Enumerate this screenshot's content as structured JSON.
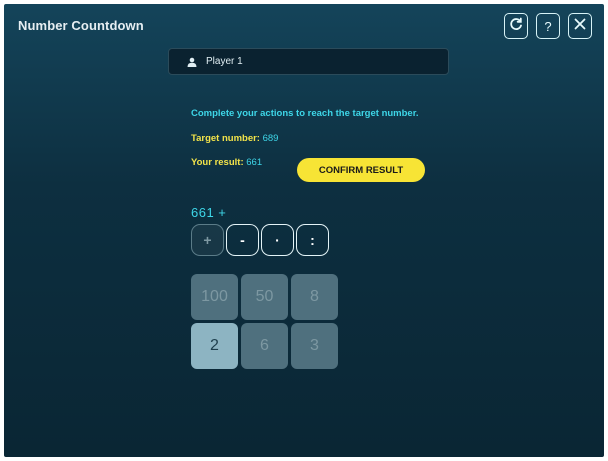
{
  "app": {
    "title": "Number Countdown"
  },
  "header_buttons": [
    {
      "name": "restart-button",
      "icon": "refresh-icon"
    },
    {
      "name": "help-button",
      "icon": "question-icon",
      "label": "?"
    },
    {
      "name": "close-button",
      "icon": "close-icon"
    }
  ],
  "player": {
    "name": "Player 1",
    "icon": "user-icon"
  },
  "instructions": "Complete your actions to reach the target number.",
  "target": {
    "label": "Target number:",
    "value": "689"
  },
  "result": {
    "label": "Your result:",
    "value": "661"
  },
  "confirm_label": "CONFIRM RESULT",
  "expression": "661 +",
  "operators": [
    {
      "symbol": "+",
      "state": "used"
    },
    {
      "symbol": "-",
      "state": "available"
    },
    {
      "symbol": "·",
      "state": "available"
    },
    {
      "symbol": ":",
      "state": "available"
    }
  ],
  "numbers": [
    {
      "value": "100",
      "state": "used"
    },
    {
      "value": "50",
      "state": "used"
    },
    {
      "value": "8",
      "state": "used"
    },
    {
      "value": "2",
      "state": "available"
    },
    {
      "value": "6",
      "state": "used"
    },
    {
      "value": "3",
      "state": "used"
    }
  ],
  "colors": {
    "accent_cyan": "#3ed6e8",
    "accent_yellow": "#f7e435",
    "background": "#0d2f40"
  }
}
